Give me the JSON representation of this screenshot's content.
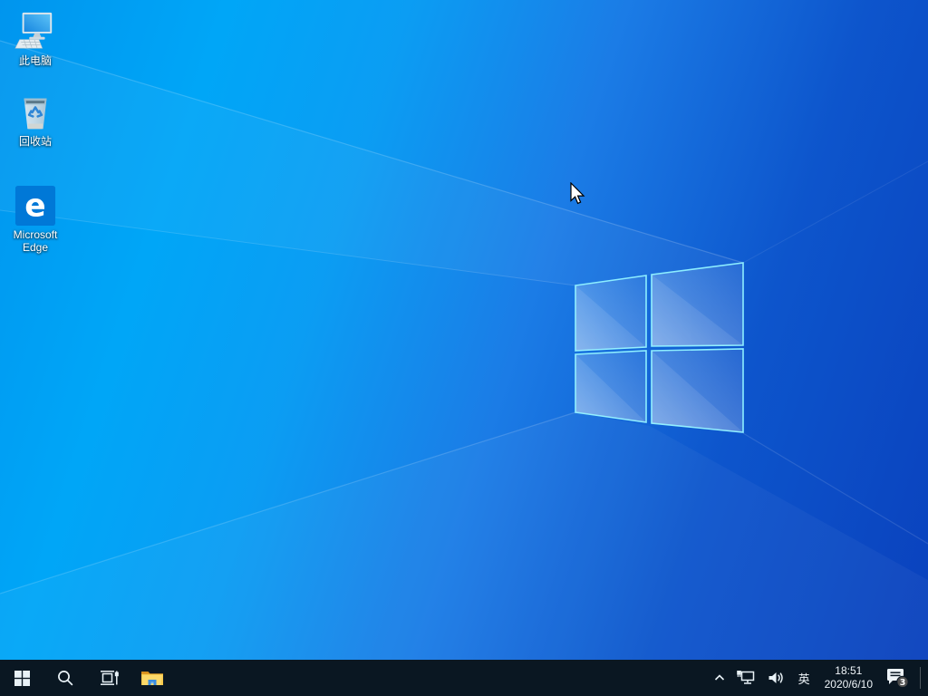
{
  "wallpaper": {
    "bg_left_color": "#00a6f7",
    "bg_right_color": "#0a41bd",
    "logo_edge_color": "#8deeff"
  },
  "desktop": {
    "icons": [
      {
        "name": "this-pc",
        "label": "此电脑"
      },
      {
        "name": "recycle-bin",
        "label": "回收站"
      },
      {
        "name": "microsoft-edge",
        "label": "Microsoft Edge"
      }
    ]
  },
  "taskbar": {
    "color": "#0a1722",
    "buttons": [
      {
        "name": "start"
      },
      {
        "name": "search"
      },
      {
        "name": "task-view"
      },
      {
        "name": "file-explorer"
      }
    ]
  },
  "tray": {
    "ime_label": "英",
    "time": "18:51",
    "date": "2020/6/10",
    "notification_count": "3"
  }
}
